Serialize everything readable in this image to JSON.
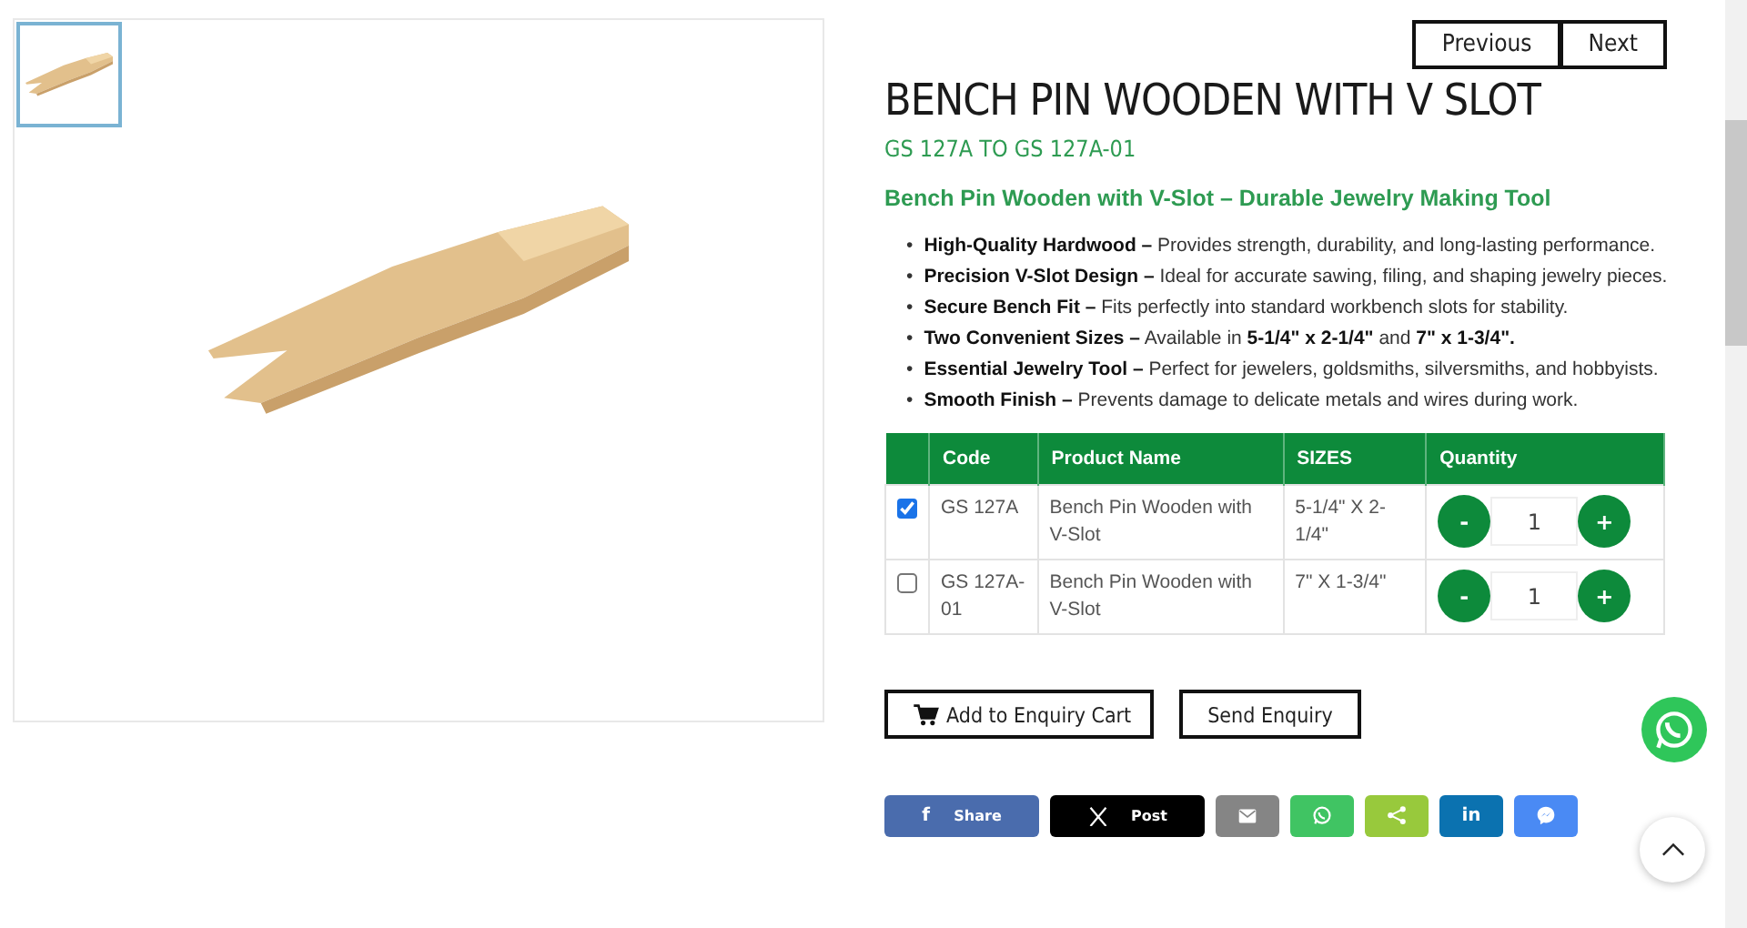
{
  "nav_buttons": [
    "Previous",
    "Next"
  ],
  "product": {
    "title": "BENCH PIN WOODEN WITH V SLOT",
    "code_range": "GS 127A TO GS 127A-01",
    "tagline": "Bench Pin Wooden with V-Slot – Durable Jewelry Making Tool",
    "features": [
      {
        "marker": "•",
        "text": "**High-Quality Hardwood –** Provides strength, durability, and long-lasting performance."
      },
      {
        "marker": "•",
        "text": "**Precision V-Slot Design –** Ideal for accurate sawing, filing, and shaping jewelry pieces."
      },
      {
        "marker": "•",
        "text": "**Secure Bench Fit –** Fits perfectly into standard workbench slots for stability."
      },
      {
        "marker": "•",
        "text": "**Two Convenient Sizes –** Available in **5-1/4\" x 2-1/4\"** and **7\" x 1-3/4\".**"
      },
      {
        "marker": "•",
        "text": "**Essential Jewelry Tool –** Perfect for jewelers, goldsmiths, silversmiths, and hobbyists."
      },
      {
        "marker": "•",
        "text": "**Smooth Finish –** Prevents damage to delicate metals and wires during work."
      }
    ]
  },
  "table": {
    "columns": [
      "Code",
      "Product Name",
      "SIZES",
      "Quantity"
    ],
    "rows": [
      {
        "checked": true,
        "code": "GS 127A",
        "name": "Bench Pin Wooden with V-Slot",
        "size": "5-1/4\" X 2-1/4\"",
        "decrement": "-",
        "quantity": "1",
        "increment": "+"
      },
      {
        "checked": false,
        "code": "GS 127A-01",
        "name": "Bench Pin Wooden with V-Slot",
        "size": "7\" X 1-3/4\"",
        "decrement": "-",
        "quantity": "1",
        "increment": "+"
      }
    ]
  },
  "actions": [
    {
      "kind": "cart",
      "label": "Add to Enquiry Cart"
    },
    {
      "kind": "plain",
      "label": "Send Enquiry"
    }
  ],
  "share": [
    {
      "kind": "facebook",
      "icon_text": "f",
      "label": "Share"
    },
    {
      "kind": "x",
      "label": "Post"
    },
    {
      "kind": "email"
    },
    {
      "kind": "whatsapp"
    },
    {
      "kind": "sharethis"
    },
    {
      "kind": "linkedin",
      "icon_text": "in"
    },
    {
      "kind": "messenger"
    }
  ]
}
